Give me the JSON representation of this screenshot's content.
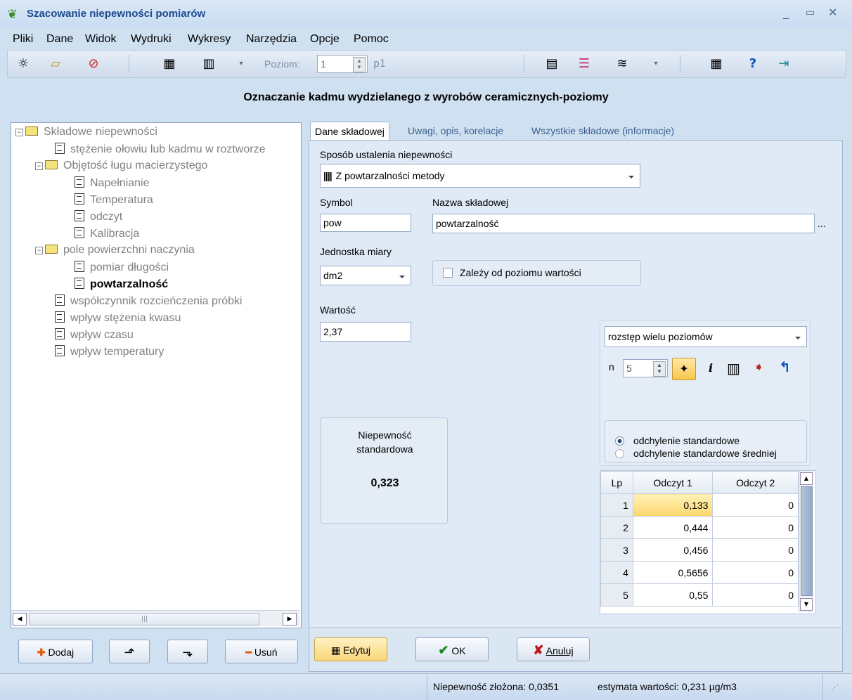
{
  "window": {
    "title": "Szacowanie niepewności pomiarów"
  },
  "menu": [
    "Pliki",
    "Dane",
    "Widok",
    "Wydruki",
    "Wykresy",
    "Narzędzia",
    "Opcje",
    "Pomoc"
  ],
  "toolbar": {
    "poziom_label": "Poziom:",
    "poziom_value": "1",
    "poziom_suffix": "p1"
  },
  "page_title": "Oznaczanie kadmu wydzielanego z wyrobów ceramicznych-poziomy",
  "tree": {
    "root": "Składowe niepewności",
    "items": [
      {
        "label": "stężenie ołowiu lub kadmu w roztworze"
      },
      {
        "label": "Objętość ługu macierzystego"
      },
      {
        "label": "Napełnianie"
      },
      {
        "label": "Temperatura"
      },
      {
        "label": "odczyt"
      },
      {
        "label": "Kalibracja"
      },
      {
        "label": "pole powierzchni naczynia"
      },
      {
        "label": "pomiar długości"
      },
      {
        "label": "powtarzalność"
      },
      {
        "label": "współczynnik rozcieńczenia próbki"
      },
      {
        "label": "wpływ stężenia kwasu"
      },
      {
        "label": "wpływ czasu"
      },
      {
        "label": "wpływ temperatury"
      }
    ]
  },
  "left_buttons": {
    "add": "Dodaj",
    "remove": "Usuń"
  },
  "tabs": [
    "Dane składowej",
    "Uwagi, opis, korelacje",
    "Wszystkie składowe (informacje)"
  ],
  "form": {
    "method_label": "Sposób ustalenia niepewności",
    "method_value": "Z powtarzalności metody",
    "symbol_label": "Symbol",
    "symbol_value": "pow",
    "name_label": "Nazwa składowej",
    "name_value": "powtarzalność",
    "name_more": "...",
    "unit_label": "Jednostka miary",
    "unit_value": "dm2",
    "depends_label": "Zależy od poziomu wartości",
    "value_label": "Wartość",
    "value_value": "2,37"
  },
  "uncertainty": {
    "label1": "Niepewność",
    "label2": "standardowa",
    "value": "0,323"
  },
  "repeat": {
    "mode": "rozstęp wielu poziomów",
    "n_label": "n",
    "n_value": "5",
    "info_icon": "i",
    "radio1": "odchylenie standardowe",
    "radio2": "odchylenie standardowe średniej"
  },
  "table": {
    "headers": [
      "Lp",
      "Odczyt 1",
      "Odczyt 2"
    ],
    "rows": [
      [
        "1",
        "0,133",
        "0"
      ],
      [
        "2",
        "0,444",
        "0"
      ],
      [
        "3",
        "0,456",
        "0"
      ],
      [
        "4",
        "0,5656",
        "0"
      ],
      [
        "5",
        "0,55",
        "0"
      ]
    ]
  },
  "bottom_buttons": {
    "edit": "Edytuj",
    "ok": "OK",
    "cancel": "Anuluj"
  },
  "status": {
    "combined": "Niepewność złożona: 0,0351",
    "estimate": "estymata wartości: 0,231 µg/m3"
  }
}
